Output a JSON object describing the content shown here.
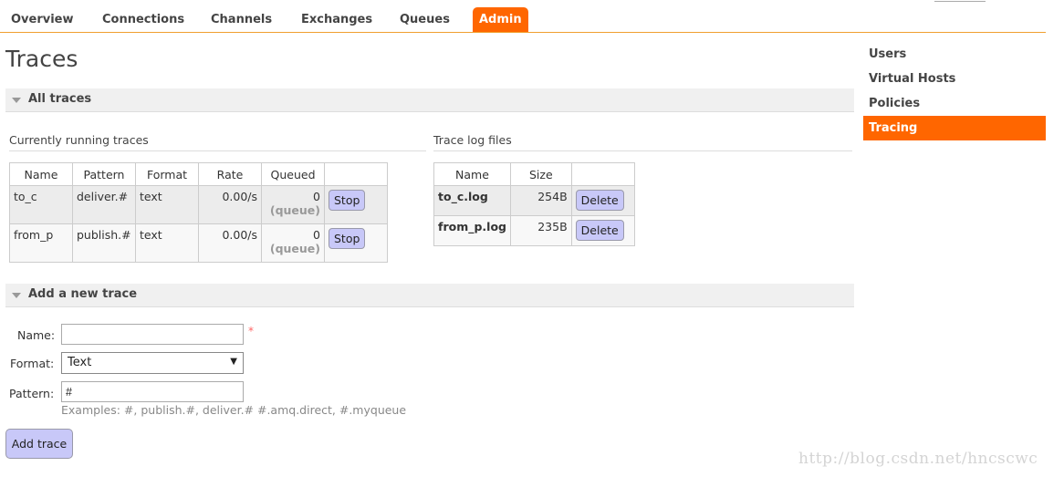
{
  "nav": {
    "tabs": [
      {
        "label": "Overview"
      },
      {
        "label": "Connections"
      },
      {
        "label": "Channels"
      },
      {
        "label": "Exchanges"
      },
      {
        "label": "Queues"
      },
      {
        "label": "Admin"
      }
    ],
    "active_tab": "Admin",
    "accent_color": "#ff6600"
  },
  "page": {
    "title": "Traces"
  },
  "all_traces": {
    "header": "All traces",
    "running": {
      "title": "Currently running traces",
      "columns": [
        "Name",
        "Pattern",
        "Format",
        "Rate",
        "Queued",
        ""
      ],
      "rows": [
        {
          "name": "to_c",
          "pattern": "deliver.#",
          "format": "text",
          "rate": "0.00/s",
          "queued": "0",
          "queued_label": "(queue)",
          "action": "Stop"
        },
        {
          "name": "from_p",
          "pattern": "publish.#",
          "format": "text",
          "rate": "0.00/s",
          "queued": "0",
          "queued_label": "(queue)",
          "action": "Stop"
        }
      ]
    },
    "logs": {
      "title": "Trace log files",
      "columns": [
        "Name",
        "Size",
        ""
      ],
      "rows": [
        {
          "name": "to_c.log",
          "size": "254B",
          "action": "Delete"
        },
        {
          "name": "from_p.log",
          "size": "235B",
          "action": "Delete"
        }
      ]
    }
  },
  "add_trace": {
    "header": "Add a new trace",
    "name_label": "Name:",
    "name_value": "",
    "required_mark": "*",
    "format_label": "Format:",
    "format_value": "Text",
    "pattern_label": "Pattern:",
    "pattern_value": "#",
    "pattern_hint": "Examples: #, publish.#, deliver.# #.amq.direct, #.myqueue",
    "submit_label": "Add trace"
  },
  "sidebar": {
    "items": [
      {
        "label": "Users"
      },
      {
        "label": "Virtual Hosts"
      },
      {
        "label": "Policies"
      },
      {
        "label": "Tracing"
      }
    ],
    "active": "Tracing"
  },
  "watermark": "http://blog.csdn.net/hncscwc"
}
